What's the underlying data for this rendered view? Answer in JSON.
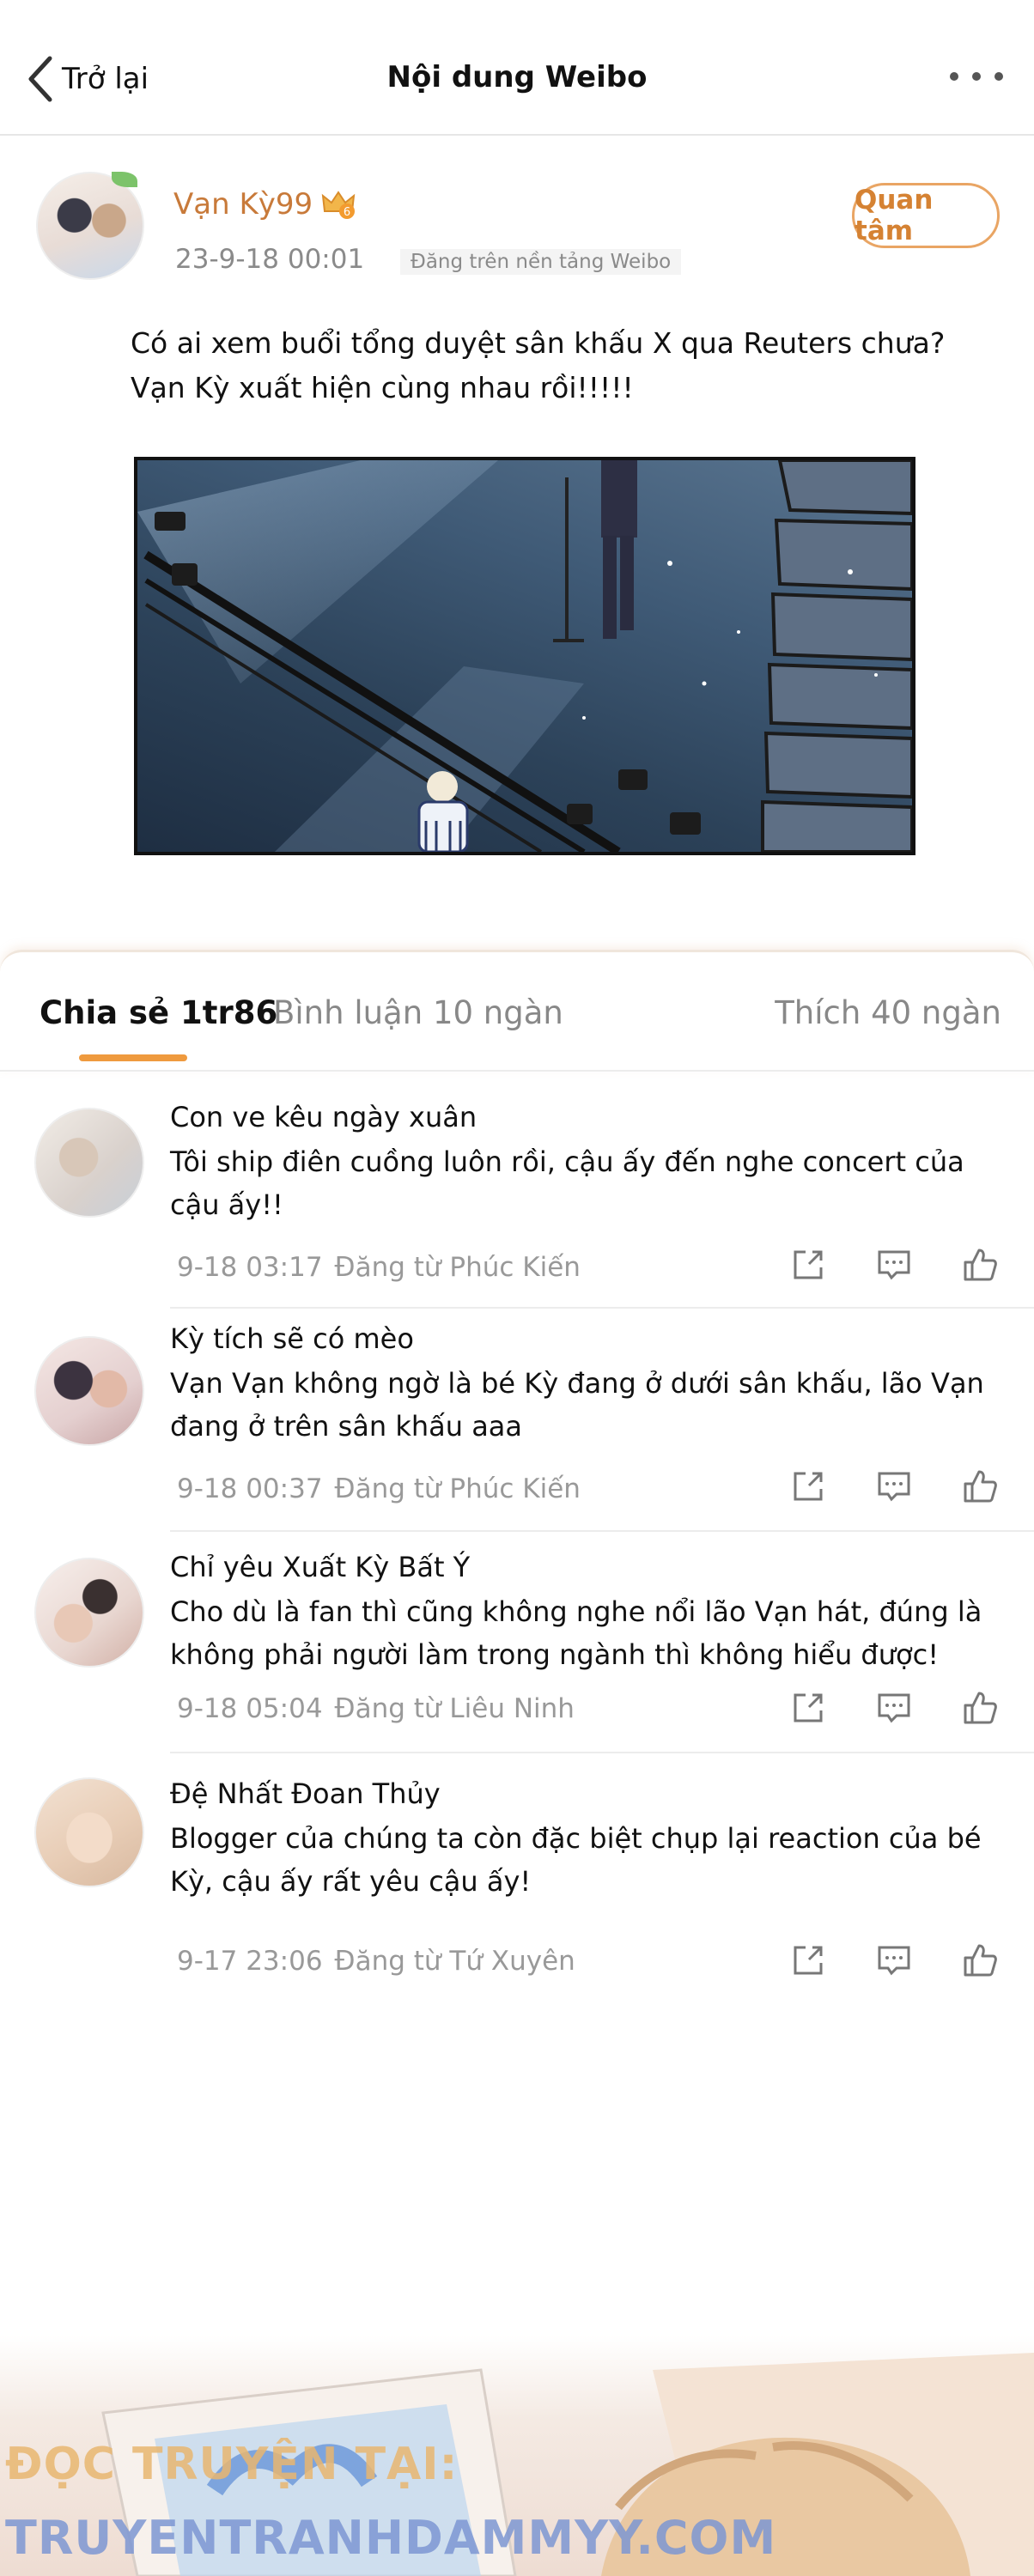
{
  "nav": {
    "back_label": "Trở lại",
    "title": "Nội dung Weibo"
  },
  "post": {
    "username": "Vạn Kỳ99",
    "badge_level": "6",
    "time": "23-9-18 00:01",
    "platform": "Đăng trên nền tảng Weibo",
    "follow_label": "Quan tâm",
    "text_lines": [
      "Có ai xem buổi tổng duyệt sân khấu X qua Reuters chưa?",
      "Vạn Kỳ xuất hiện cùng nhau rồi!!!!!"
    ]
  },
  "tabs": {
    "share": "Chia sẻ 1tr86",
    "comments": "Bình luận 10 ngàn",
    "likes": "Thích 40 ngàn"
  },
  "comments": [
    {
      "name": "Con ve kêu ngày xuân",
      "lines": [
        "Tôi ship điên cuồng luôn rồi, cậu ấy đến nghe concert của",
        "cậu ấy!!"
      ],
      "time": "9-18 03:17",
      "source": "Đăng từ Phúc Kiến"
    },
    {
      "name": "Kỳ tích sẽ có mèo",
      "lines": [
        "Vạn Vạn không ngờ là bé Kỳ đang ở dưới sân khấu, lão Vạn",
        "đang ở trên sân khấu aaa"
      ],
      "time": "9-18 00:37",
      "source": "Đăng từ Phúc Kiến"
    },
    {
      "name": "Chỉ yêu Xuất Kỳ Bất Ý",
      "lines": [
        "Cho dù là fan thì cũng không nghe nổi lão Vạn hát, đúng là",
        "không phải người làm trong ngành thì không hiểu được!"
      ],
      "time": "9-18 05:04",
      "source": "Đăng từ Liêu Ninh"
    },
    {
      "name": "Đệ Nhất Đoan Thủy",
      "lines": [
        "Blogger của chúng ta còn đặc biệt chụp lại reaction của bé",
        "Kỳ, cậu ấy rất yêu cậu ấy!"
      ],
      "time": "9-17 23:06",
      "source": "Đăng từ Tứ Xuyên"
    }
  ],
  "icons": [
    "back-chevron-icon",
    "more-dots-icon",
    "crown-badge-icon",
    "share-icon",
    "comment-icon",
    "like-icon"
  ],
  "colors": {
    "accent_orange": "#ef9a3e",
    "username": "#c87a3a",
    "meta_gray": "#999999"
  },
  "watermark": {
    "line1": "ĐỌC TRUYỆN TẠI:",
    "line2": "TRUYENTRANHDAMMYY.COM"
  }
}
